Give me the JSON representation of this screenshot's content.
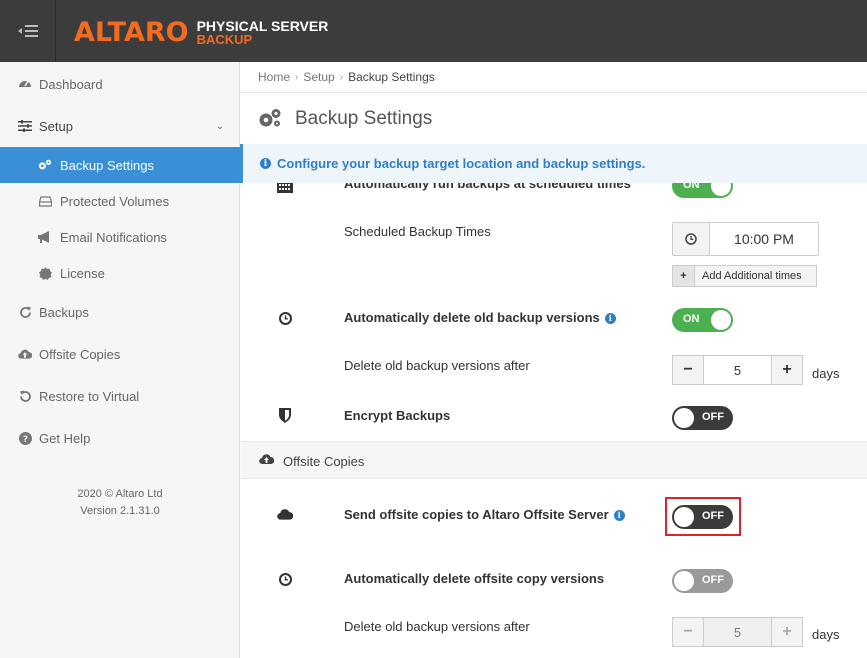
{
  "header": {
    "logo_main": "ALTARO",
    "logo_line1": "PHYSICAL SERVER",
    "logo_line2": "BACKUP",
    "accent": "#f26b21"
  },
  "sidebar": {
    "items": [
      {
        "label": "Dashboard",
        "icon": "dashboard-icon"
      },
      {
        "label": "Setup",
        "icon": "sliders-icon"
      },
      {
        "label": "Backup Settings",
        "icon": "gears-icon",
        "active": true
      },
      {
        "label": "Protected Volumes",
        "icon": "hdd-icon"
      },
      {
        "label": "Email Notifications",
        "icon": "megaphone-icon"
      },
      {
        "label": "License",
        "icon": "badge-icon"
      },
      {
        "label": "Backups",
        "icon": "refresh-icon"
      },
      {
        "label": "Offsite Copies",
        "icon": "cloud-upload-icon"
      },
      {
        "label": "Restore to Virtual",
        "icon": "undo-icon"
      },
      {
        "label": "Get Help",
        "icon": "question-icon"
      }
    ],
    "footer_line1": "2020 © Altaro Ltd",
    "footer_line2": "Version 2.1.31.0",
    "active_color": "#3a8fd6"
  },
  "breadcrumb": {
    "home": "Home",
    "setup": "Setup",
    "current": "Backup Settings"
  },
  "page_title": "Backup Settings",
  "info_bar": "Configure your backup target location and backup settings.",
  "settings": {
    "auto_run_label": "Automatically run backups at scheduled times",
    "auto_run_state": "ON",
    "scheduled_times_label": "Scheduled Backup Times",
    "scheduled_time": "10:00 PM",
    "add_times_label": "Add Additional times",
    "auto_delete_label": "Automatically delete old backup versions",
    "auto_delete_state": "ON",
    "delete_after_label": "Delete old backup versions after",
    "delete_after_value": "5",
    "delete_after_unit": "days",
    "encrypt_label": "Encrypt Backups",
    "encrypt_state": "OFF"
  },
  "offsite": {
    "section_title": "Offsite Copies",
    "send_label": "Send offsite copies to Altaro Offsite Server",
    "send_state": "OFF",
    "auto_delete_label": "Automatically delete offsite copy versions",
    "auto_delete_state": "OFF",
    "delete_after_label": "Delete old backup versions after",
    "delete_after_value": "5",
    "delete_after_unit": "days"
  },
  "colors": {
    "on": "#4cb050",
    "off": "#3b3b3b",
    "highlight": "#d9232e",
    "info": "#2f7fc8"
  }
}
